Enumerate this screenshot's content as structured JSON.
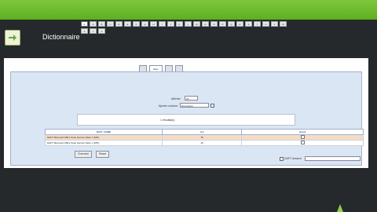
{
  "header": {
    "app_title": "",
    "page_title": "Dictionnaire",
    "icon": "arrow-right-icon"
  },
  "tabs": [
    {
      "label": "",
      "active": false
    },
    {
      "label": "Mots",
      "active": true
    },
    {
      "label": "",
      "active": false
    },
    {
      "label": "",
      "active": false
    }
  ],
  "letters": [
    "0",
    "A",
    "B",
    "C",
    "D",
    "E",
    "F",
    "G",
    "H",
    "I",
    "J",
    "K",
    "L",
    "M",
    "N",
    "O",
    "P",
    "Q",
    "R",
    "S",
    "T",
    "U",
    "V",
    "W",
    "X",
    "Y",
    "Z"
  ],
  "filters": {
    "afficher_label": "Afficher",
    "afficher_value": "25",
    "ajouter_label": "Ajouter colonne",
    "ajouter_value": "Description"
  },
  "message": "1 résultat(s)",
  "table": {
    "columns": [
      "DAFT_NAME",
      "ord",
      "check"
    ],
    "rows": [
      {
        "name": "DAFT Microsoft Office Suite Service Pack 1 (SP1)",
        "value": "78",
        "checked": false
      },
      {
        "name": "DAFT Microsoft Office Suite Service Pack 1 (SP1)",
        "value": "16",
        "checked": false
      }
    ]
  },
  "buttons": {
    "chercher": "Chercher",
    "reset": "Reset"
  },
  "checkbox_label": "DAFT desired"
}
